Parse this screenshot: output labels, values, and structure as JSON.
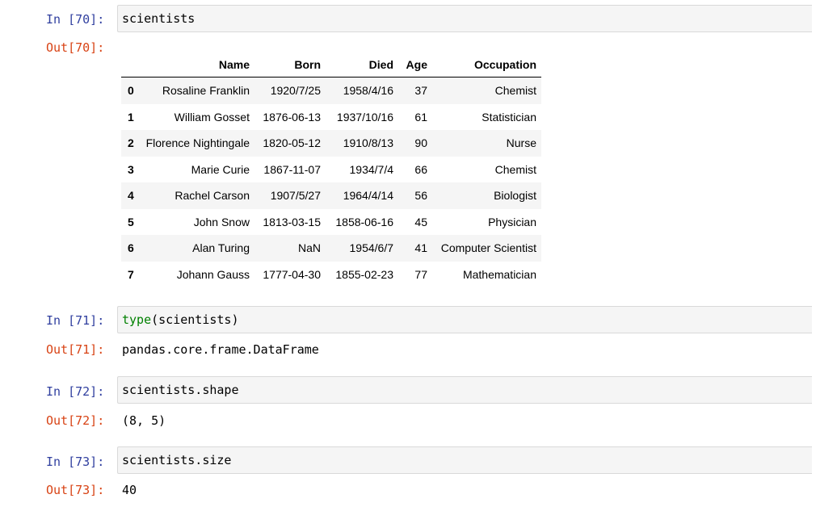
{
  "cells": {
    "c70": {
      "in_prompt": "In [70]:",
      "code": "scientists",
      "out_prompt": "Out[70]:"
    },
    "c71": {
      "in_prompt": "In [71]:",
      "code_builtin": "type",
      "code_rest": "(scientists)",
      "out_prompt": "Out[71]:",
      "output": "pandas.core.frame.DataFrame"
    },
    "c72": {
      "in_prompt": "In [72]:",
      "code": "scientists.shape",
      "out_prompt": "Out[72]:",
      "output": "(8, 5)"
    },
    "c73": {
      "in_prompt": "In [73]:",
      "code": "scientists.size",
      "out_prompt": "Out[73]:",
      "output": "40"
    }
  },
  "dataframe": {
    "columns": [
      "",
      "Name",
      "Born",
      "Died",
      "Age",
      "Occupation"
    ],
    "rows": [
      [
        "0",
        "Rosaline Franklin",
        "1920/7/25",
        "1958/4/16",
        "37",
        "Chemist"
      ],
      [
        "1",
        "William Gosset",
        "1876-06-13",
        "1937/10/16",
        "61",
        "Statistician"
      ],
      [
        "2",
        "Florence Nightingale",
        "1820-05-12",
        "1910/8/13",
        "90",
        "Nurse"
      ],
      [
        "3",
        "Marie Curie",
        "1867-11-07",
        "1934/7/4",
        "66",
        "Chemist"
      ],
      [
        "4",
        "Rachel Carson",
        "1907/5/27",
        "1964/4/14",
        "56",
        "Biologist"
      ],
      [
        "5",
        "John Snow",
        "1813-03-15",
        "1858-06-16",
        "45",
        "Physician"
      ],
      [
        "6",
        "Alan Turing",
        "NaN",
        "1954/6/7",
        "41",
        "Computer Scientist"
      ],
      [
        "7",
        "Johann Gauss",
        "1777-04-30",
        "1855-02-23",
        "77",
        "Mathematician"
      ]
    ]
  },
  "colors": {
    "in_prompt": "#303f9f",
    "out_prompt": "#d84315",
    "builtin_keyword": "#008000",
    "cell_background": "#f5f5f5"
  }
}
